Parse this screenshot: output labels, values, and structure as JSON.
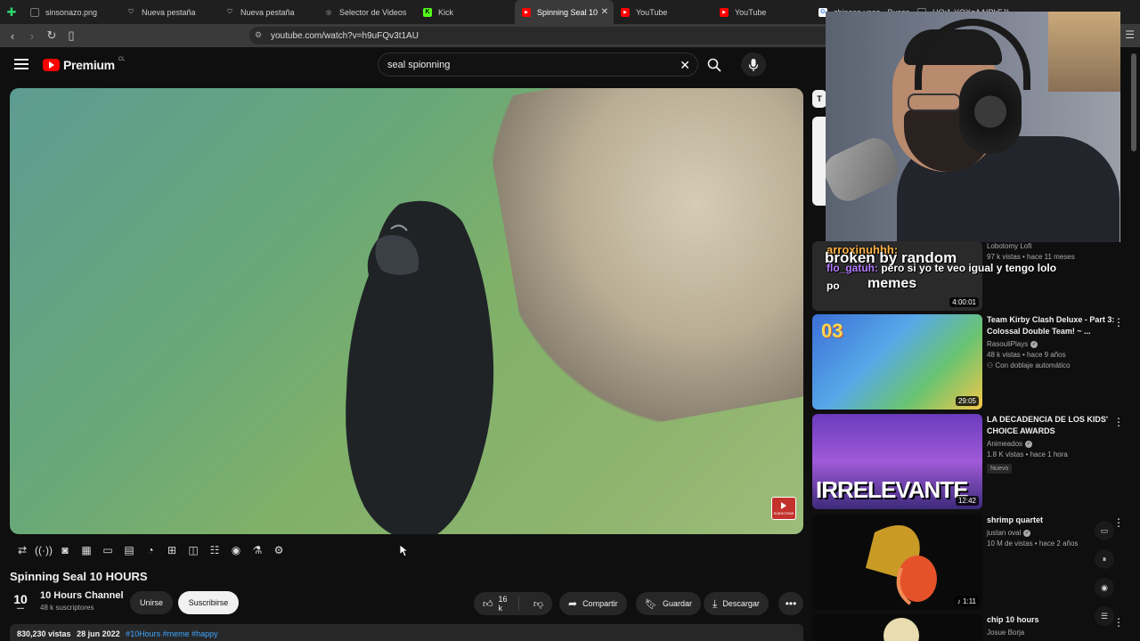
{
  "browser": {
    "tabs": [
      {
        "label": "sinsonazo.png",
        "icon": "file-icon",
        "color": "#888888"
      },
      {
        "label": "Nueva pestaña",
        "icon": "shield-icon",
        "color": "#bbbbbb"
      },
      {
        "label": "Nueva pestaña",
        "icon": "shield-icon",
        "color": "#bbbbbb"
      },
      {
        "label": "Selector de Videos",
        "icon": "globe-icon",
        "color": "#bbbbbb"
      },
      {
        "label": "Kick",
        "icon": "kick-icon",
        "color": "#53fc18"
      },
      {
        "label": "Spinning Seal 10",
        "icon": "youtube-icon",
        "color": "#ff0000",
        "active": true
      },
      {
        "label": "YouTube",
        "icon": "youtube-icon",
        "color": "#ff0000"
      },
      {
        "label": "YouTube",
        "icon": "youtube-icon",
        "color": "#ff0000"
      },
      {
        "label": "chinese vase - Buscar",
        "icon": "google-icon",
        "color": "#ffffff"
      },
      {
        "label": "HQ:1-YQXgAAIPkFJIf",
        "icon": "image-icon",
        "color": "#888888"
      }
    ],
    "url": "youtube.com/watch?v=h9uFQv3t1AU"
  },
  "youtube": {
    "logo_text": "Premium",
    "country": "CL",
    "search_value": "seal spionning"
  },
  "video": {
    "title": "Spinning Seal 10 HOURS",
    "channel_name": "10 Hours Channel",
    "channel_avatar_text": "10",
    "subscribers": "48 k suscriptores",
    "join_label": "Unirse",
    "subscribe_label": "Suscribirse",
    "likes": "16 k",
    "share_label": "Compartir",
    "save_label": "Guardar",
    "download_label": "Descargar",
    "views": "830,230 vistas",
    "date": "28 jun 2022",
    "hashtags": "#10Hours #meme #happy",
    "subscribe_badge": "SUBSCRIBE"
  },
  "chat_overlay": {
    "line1_user": "arroxinuhhh:",
    "line1_text": "broken by random",
    "line2_user": "flo_gatuh:",
    "line2_text": "pero si yo te veo igual y tengo",
    "line2_end": "lolo",
    "line3_text": "po",
    "line3_word": "memes"
  },
  "recommendations": [
    {
      "title": "",
      "channel": "Lobotomy Lofi",
      "meta": "97 k vistas • hace 11 meses",
      "duration": "4:00:01"
    },
    {
      "title": "Team Kirby Clash Deluxe - Part 3: Colossal Double Team! ~ ...",
      "channel": "RasouliPlays",
      "meta": "48 k vistas • hace 9 años",
      "badge": "Con doblaje automático",
      "duration": "29:05",
      "thumb_text": "03"
    },
    {
      "title": "LA DECADENCIA DE LOS KIDS' CHOICE AWARDS",
      "channel": "Animeados",
      "meta": "1.8 K vistas • hace 1 hora",
      "badge": "Nuevo",
      "duration": "12:42",
      "thumb_text": "IRRELEVANTE"
    },
    {
      "title": "shrimp quartet",
      "channel": "justan oval",
      "meta": "10 M de vistas • hace 2 años",
      "duration": "1:11"
    },
    {
      "title": "chip 10 hours",
      "channel": "Josue Borja",
      "meta": "",
      "duration": ""
    }
  ],
  "colors": {
    "accent": "#ff0000",
    "link": "#3ea6ff",
    "background": "#0f0f0f"
  }
}
